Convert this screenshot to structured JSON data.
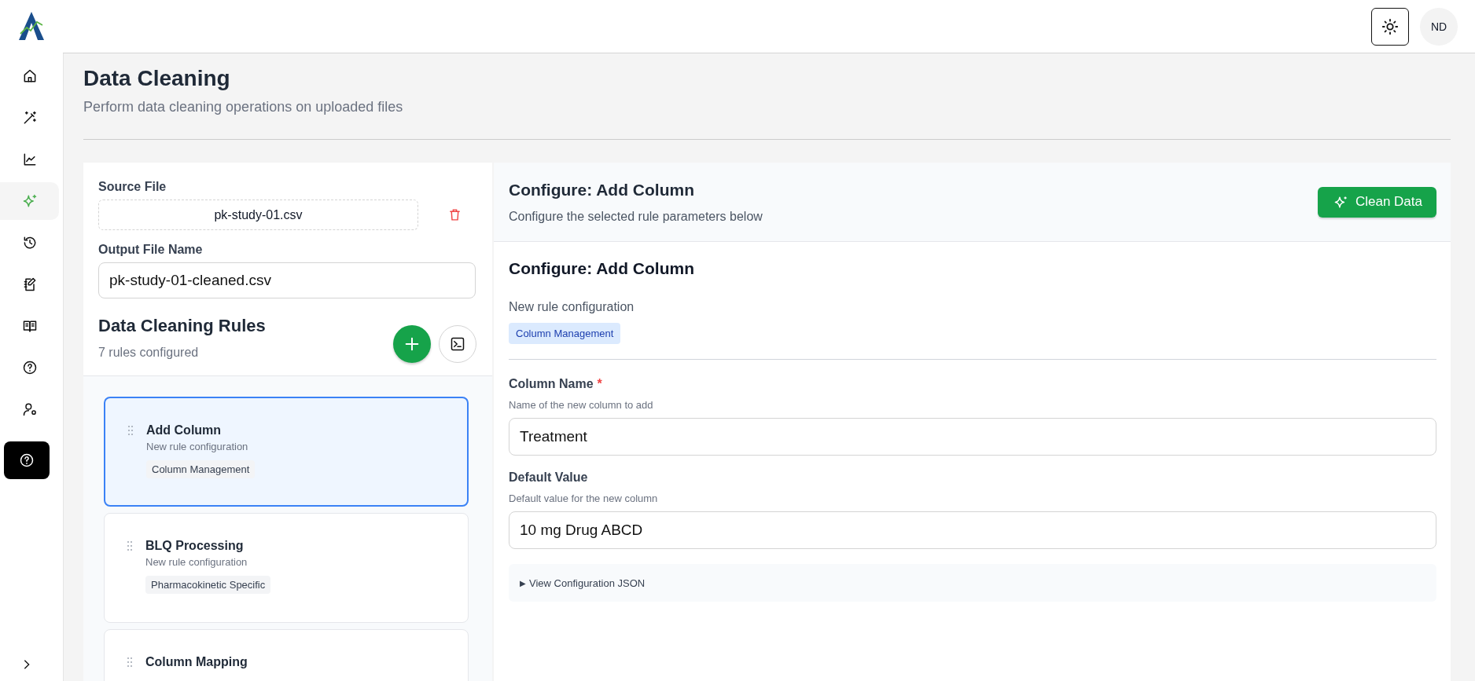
{
  "topbar": {
    "avatar": "ND"
  },
  "nav": [
    {
      "kind": "home",
      "selected": false
    },
    {
      "kind": "wand",
      "selected": false
    },
    {
      "kind": "chart",
      "selected": false
    },
    {
      "kind": "sparkles",
      "selected": true
    },
    {
      "kind": "history",
      "selected": false
    },
    {
      "kind": "notebook",
      "selected": false
    },
    {
      "kind": "book",
      "selected": false
    },
    {
      "kind": "help",
      "selected": false
    },
    {
      "kind": "user-settings",
      "selected": false
    }
  ],
  "page": {
    "title": "Data Cleaning",
    "subtitle": "Perform data cleaning operations on uploaded files"
  },
  "source": {
    "label": "Source File",
    "file": "pk-study-01.csv",
    "output_label": "Output File Name",
    "output_value": "pk-study-01-cleaned.csv"
  },
  "rules": {
    "title": "Data Cleaning Rules",
    "count": "7 rules configured",
    "items": [
      {
        "name": "Add Column",
        "description": "New rule configuration",
        "category": "Column Management",
        "selected": true
      },
      {
        "name": "BLQ Processing",
        "description": "New rule configuration",
        "category": "Pharmacokinetic Specific",
        "selected": false
      },
      {
        "name": "Column Mapping",
        "selected": false
      }
    ]
  },
  "config": {
    "header_title": "Configure: Add Column",
    "header_subtitle": "Configure the selected rule parameters below",
    "clean_button": "Clean Data",
    "title": "Configure: Add Column",
    "description": "New rule configuration",
    "category": "Column Management",
    "fields": [
      {
        "label": "Column Name",
        "required_mark": "*",
        "hint": "Name of the new column to add",
        "value": "Treatment"
      },
      {
        "label": "Default Value",
        "hint": "Default value for the new column",
        "value": "10 mg Drug ABCD"
      }
    ],
    "json_toggle": {
      "arrow": "▶",
      "label": "View Configuration JSON"
    }
  }
}
